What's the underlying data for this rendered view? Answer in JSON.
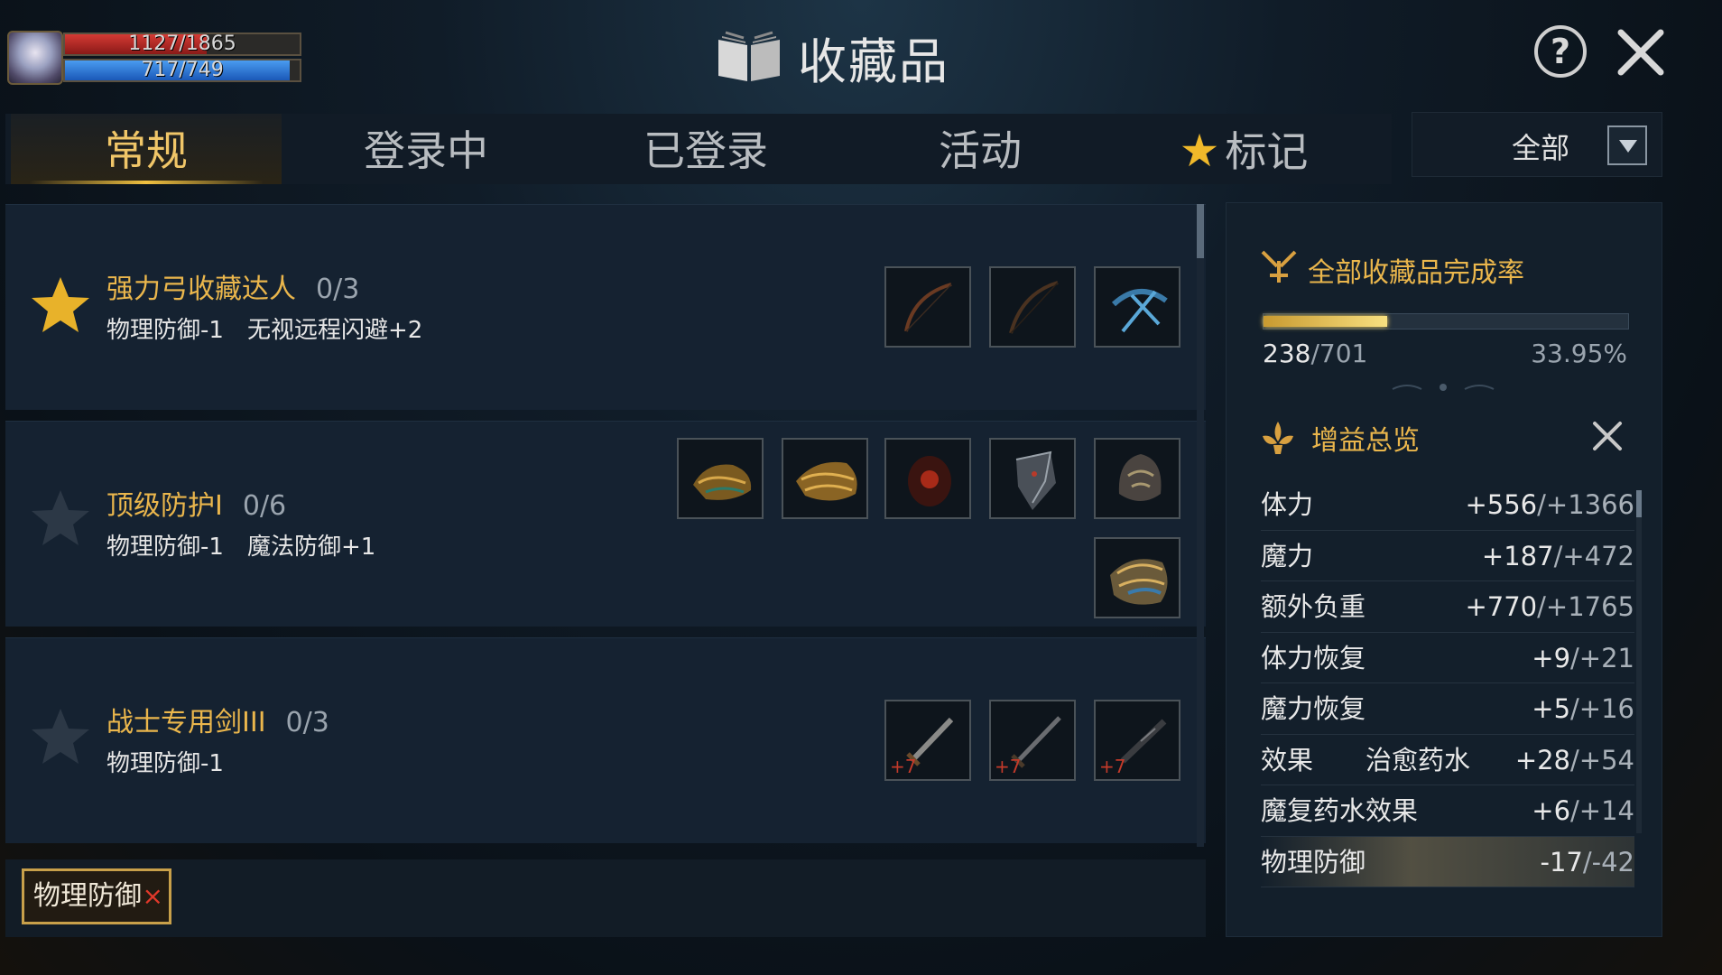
{
  "player": {
    "hp": "1127/1865",
    "mp": "717/749",
    "hp_fraction": 0.604,
    "mp_fraction": 0.957
  },
  "header": {
    "title": "收藏品"
  },
  "tabs": [
    {
      "label": "常规",
      "active": true
    },
    {
      "label": "登录中",
      "active": false
    },
    {
      "label": "已登录",
      "active": false
    },
    {
      "label": "活动",
      "active": false
    },
    {
      "label": "标记",
      "active": false,
      "icon": "star-icon"
    }
  ],
  "filter": {
    "selected": "全部"
  },
  "collections": [
    {
      "title": "强力弓收藏达人",
      "count": "0/3",
      "bonuses": [
        "物理防御-1",
        "无视远程闪避+2"
      ],
      "starred": true,
      "slots": [
        "bow-icon",
        "bow-icon",
        "crossbow-icon"
      ]
    },
    {
      "title": "顶级防护I",
      "count": "0/6",
      "bonuses": [
        "物理防御-1",
        "魔法防御+1"
      ],
      "starred": false,
      "slots": [
        "gauntlet-icon",
        "gauntlet-icon",
        "cloak-icon",
        "shield-icon",
        "helmet-icon",
        "bracer-icon"
      ]
    },
    {
      "title": "战士专用剑III",
      "count": "0/3",
      "bonuses": [
        "物理防御-1"
      ],
      "starred": false,
      "slots": [
        "sword-icon",
        "sword-icon",
        "sword-icon"
      ],
      "enhance": "+7"
    }
  ],
  "active_filter_tag": {
    "label": "物理防御"
  },
  "summary": {
    "title": "全部收藏品完成率",
    "collected": "238",
    "total": "/701",
    "percent": "33.95%",
    "progress_fraction": 0.3395
  },
  "buffs": {
    "title": "增益总览",
    "stats": [
      {
        "name": "体力",
        "value": "+556",
        "total": "/+1366"
      },
      {
        "name": "魔力",
        "value": "+187",
        "total": "/+472"
      },
      {
        "name": "额外负重",
        "value": "+770",
        "total": "/+1765"
      },
      {
        "name": "体力恢复",
        "value": "+9",
        "total": "/+21"
      },
      {
        "name": "魔力恢复",
        "value": "+5",
        "total": "/+16"
      },
      {
        "name": "效果　　治愈药水",
        "value": "+28",
        "total": "/+54"
      },
      {
        "name": "魔复药水效果",
        "value": "+6",
        "total": "/+14"
      },
      {
        "name": "物理防御",
        "value": "-17",
        "total": "/-42"
      }
    ]
  },
  "colors": {
    "gold": "#eab64c",
    "tab_active": "#f0c668",
    "hp": "#d43a34",
    "mp": "#4a9cf0"
  }
}
